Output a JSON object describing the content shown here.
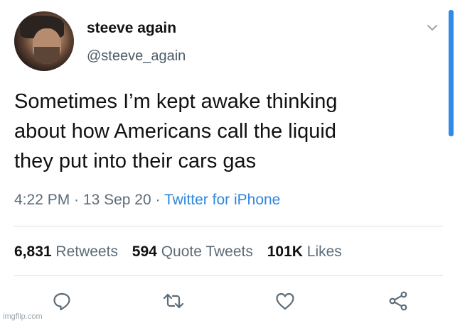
{
  "user": {
    "name": "steeve again",
    "handle": "@steeve_again"
  },
  "tweet": {
    "lines": [
      "Sometimes I’m kept awake thinking",
      "about how Americans call the liquid",
      "they put into their cars gas"
    ],
    "time": "4:22 PM",
    "date": "13 Sep 20",
    "source": "Twitter for iPhone",
    "sep": " · "
  },
  "stats": {
    "retweets_count": "6,831",
    "retweets_label": "Retweets",
    "quotes_count": "594",
    "quotes_label": "Quote Tweets",
    "likes_count": "101K",
    "likes_label": "Likes"
  },
  "actions": [
    {
      "icon": "reply-icon"
    },
    {
      "icon": "retweet-icon"
    },
    {
      "icon": "like-icon"
    },
    {
      "icon": "share-icon"
    }
  ],
  "watermark": "imgflip.com",
  "colors": {
    "link": "#2f86de",
    "secondary_text": "#5d6c78",
    "divider": "#d9e1e6",
    "icon": "#5d6c78"
  }
}
